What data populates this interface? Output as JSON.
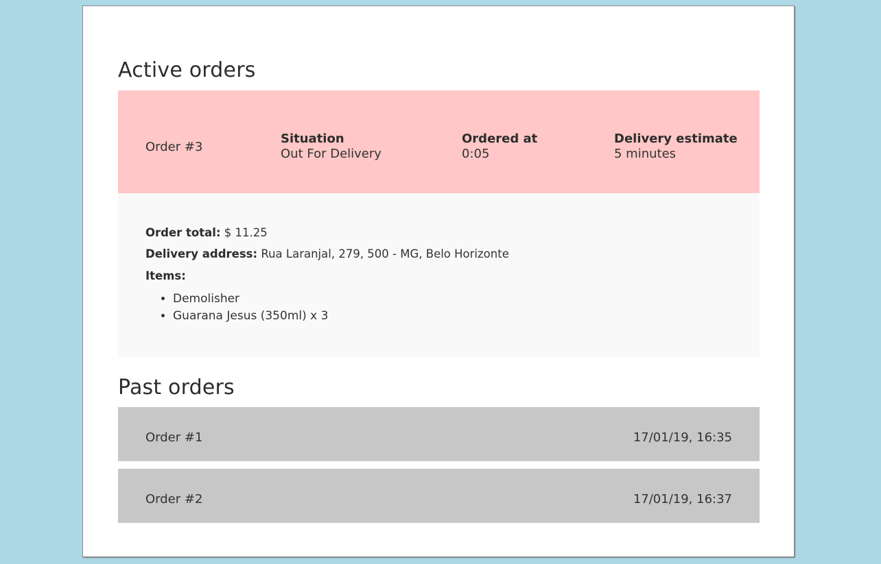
{
  "active": {
    "title": "Active orders",
    "order": {
      "label": "Order #3",
      "situation_label": "Situation",
      "situation_value": "Out For Delivery",
      "ordered_at_label": "Ordered at",
      "ordered_at_value": "0:05",
      "estimate_label": "Delivery estimate",
      "estimate_value": "5 minutes",
      "total_label": "Order total:",
      "total_value": "$ 11.25",
      "address_label": "Delivery address:",
      "address_value": "Rua Laranjal, 279, 500 - MG, Belo Horizonte",
      "items_label": "Items:",
      "items": [
        "Demolisher",
        "Guarana Jesus (350ml) x 3"
      ]
    }
  },
  "past": {
    "title": "Past orders",
    "orders": [
      {
        "label": "Order #1",
        "date": "17/01/19, 16:35"
      },
      {
        "label": "Order #2",
        "date": "17/01/19, 16:37"
      }
    ]
  },
  "colors": {
    "page_background": "#add8e6",
    "active_header": "#ffc7c7",
    "active_details": "#f9f9f9",
    "past_row": "#c7c7c7"
  }
}
